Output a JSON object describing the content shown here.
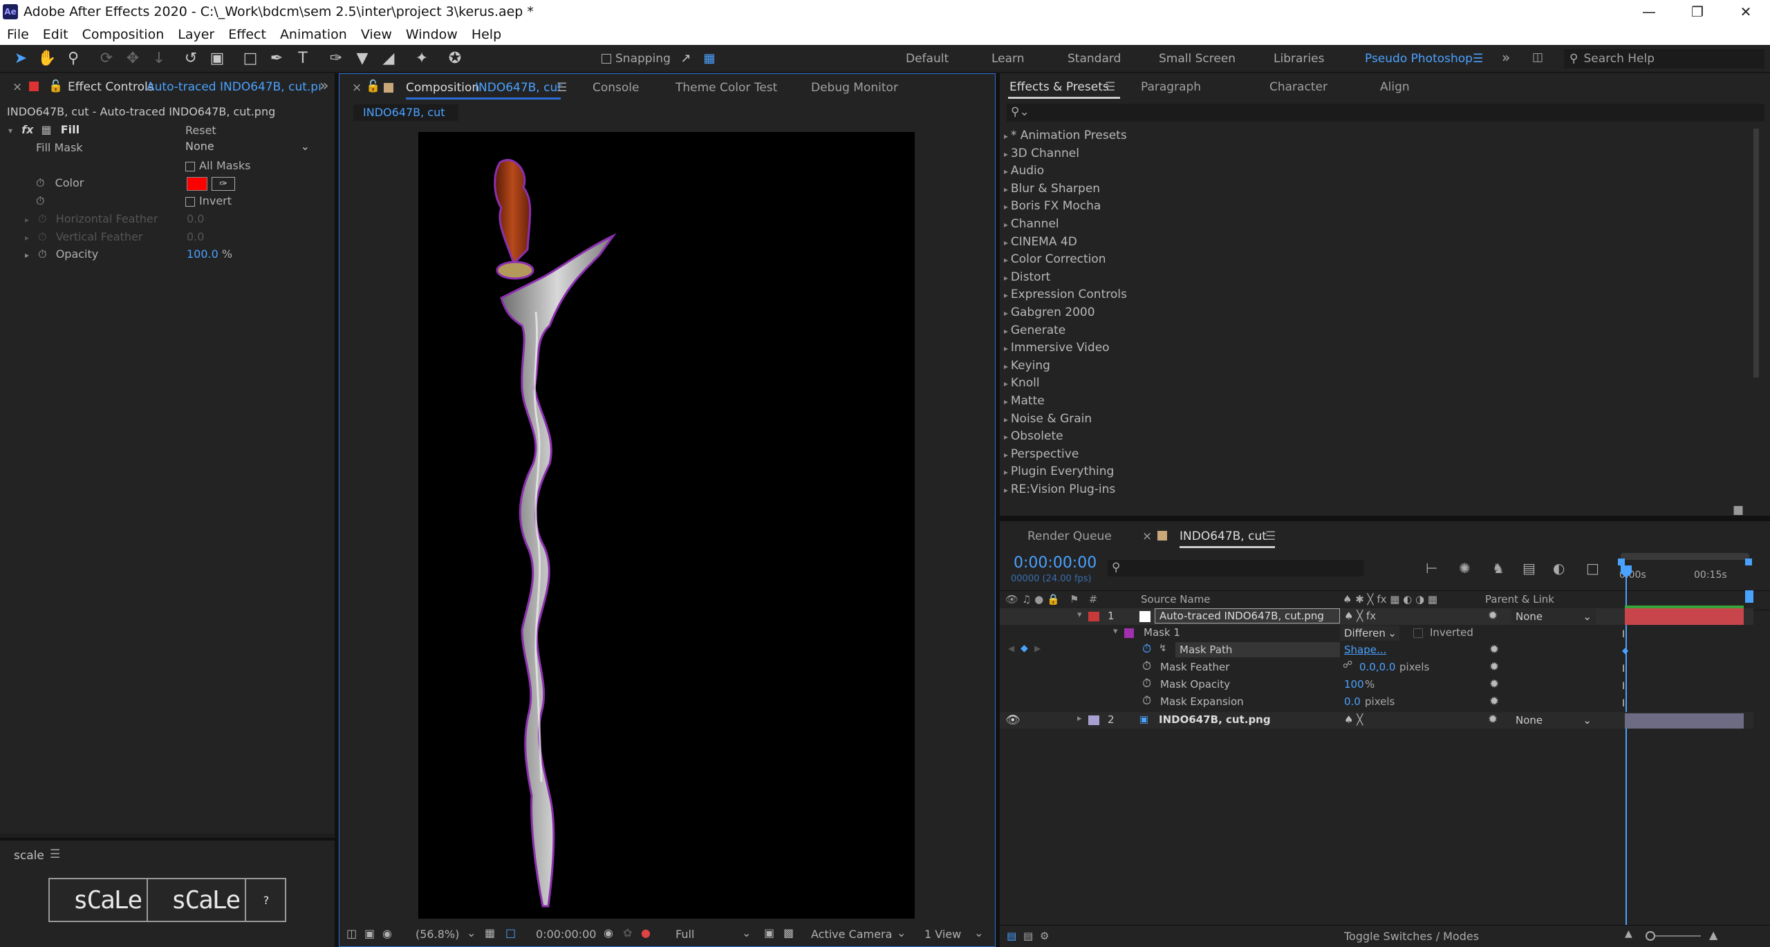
{
  "title": "Adobe After Effects 2020 - C:\\_Work\\bdcm\\sem 2.5\\inter\\project 3\\kerus.aep *",
  "menu": [
    "File",
    "Edit",
    "Composition",
    "Layer",
    "Effect",
    "Animation",
    "View",
    "Window",
    "Help"
  ],
  "toolbar": {
    "snapping": "Snapping",
    "workspaces": [
      "Default",
      "Learn",
      "Standard",
      "Small Screen",
      "Libraries",
      "Pseudo Photoshop"
    ],
    "active_workspace": "Pseudo Photoshop",
    "search_placeholder": "Search Help"
  },
  "effect_controls": {
    "tab_label": "Effect Controls",
    "tab_layer": "Auto-traced INDO647B, cut.pı",
    "breadcrumb": "INDO647B, cut - Auto-traced INDO647B, cut.png",
    "effect_name": "Fill",
    "reset": "Reset",
    "fill_mask_label": "Fill Mask",
    "fill_mask_value": "None",
    "all_masks": "All Masks",
    "color_label": "Color",
    "color_value": "#ff0000",
    "invert": "Invert",
    "horizontal_feather": "Horizontal Feather",
    "horizontal_feather_value": "0.0",
    "vertical_feather": "Vertical Feather",
    "vertical_feather_value": "0.0",
    "opacity_label": "Opacity",
    "opacity_value": "100.0",
    "opacity_unit": "%"
  },
  "scale_panel": {
    "title": "scale",
    "buttons": [
      "sCaLe",
      "sCaLe",
      "?"
    ]
  },
  "composition": {
    "tabs": [
      "Composition",
      "Console",
      "Theme Color Test",
      "Debug Monitor"
    ],
    "comp_name": "INDO647B, cut",
    "subtab": "INDO647B, cut",
    "zoom": "(56.8%)",
    "timecode": "0:00:00:00",
    "resolution": "Full",
    "camera": "Active Camera",
    "view": "1 View"
  },
  "effects_presets": {
    "tabs": [
      "Effects & Presets",
      "Paragraph",
      "Character",
      "Align"
    ],
    "categories": [
      "* Animation Presets",
      "3D Channel",
      "Audio",
      "Blur & Sharpen",
      "Boris FX Mocha",
      "Channel",
      "CINEMA 4D",
      "Color Correction",
      "Distort",
      "Expression Controls",
      "Gabgren 2000",
      "Generate",
      "Immersive Video",
      "Keying",
      "Knoll",
      "Matte",
      "Noise & Grain",
      "Obsolete",
      "Perspective",
      "Plugin Everything",
      "RE:Vision Plug-ins"
    ]
  },
  "timeline": {
    "tabs": [
      "Render Queue",
      "INDO647B, cut"
    ],
    "timecode": "0:00:00:00",
    "fps": "00000 (24.00 fps)",
    "col_source": "Source Name",
    "col_parent": "Parent & Link",
    "ruler": [
      "0:00s",
      "00:15s"
    ],
    "layer1": {
      "num": "1",
      "name": "Auto-traced INDO647B, cut.png",
      "parent": "None"
    },
    "mask": {
      "name": "Mask 1",
      "mode": "Differen",
      "inverted": "Inverted"
    },
    "mask_path": {
      "label": "Mask Path",
      "value": "Shape..."
    },
    "mask_feather": {
      "label": "Mask Feather",
      "value": "0.0,0.0",
      "unit": "pixels"
    },
    "mask_opacity": {
      "label": "Mask Opacity",
      "value": "100",
      "unit": "%"
    },
    "mask_expansion": {
      "label": "Mask Expansion",
      "value": "0.0",
      "unit": "pixels"
    },
    "layer2": {
      "num": "2",
      "name": "INDO647B, cut.png",
      "parent": "None"
    },
    "footer": "Toggle Switches / Modes"
  }
}
